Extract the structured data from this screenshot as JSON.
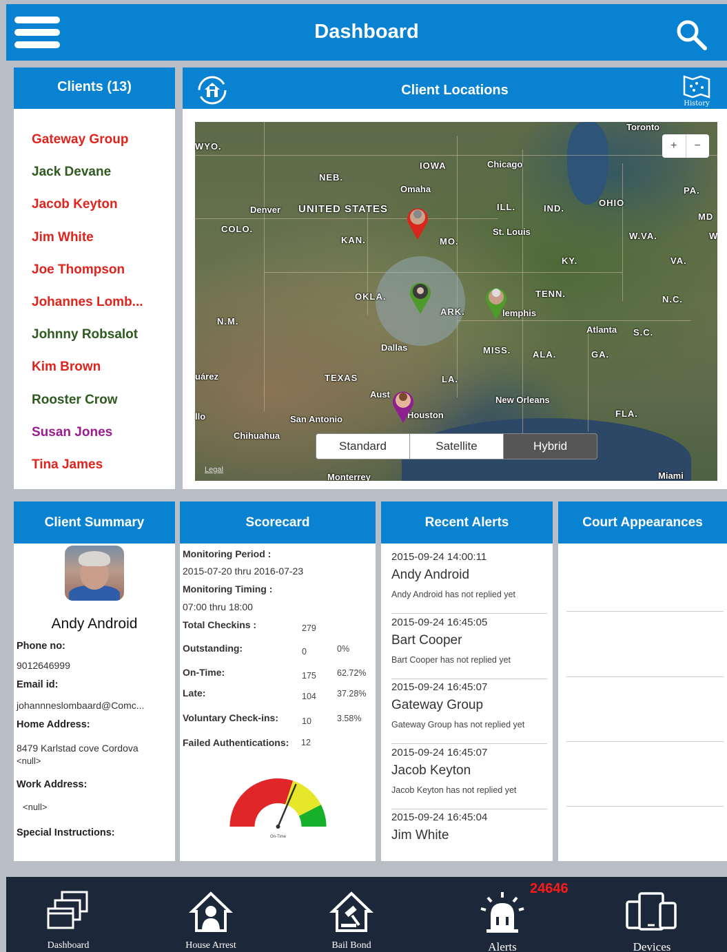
{
  "header": {
    "title": "Dashboard"
  },
  "clients": {
    "title": "Clients (13)",
    "items": [
      {
        "label": "Gateway Group",
        "color": "#e0231c"
      },
      {
        "label": "Jack Devane",
        "color": "#2e5a1f"
      },
      {
        "label": "Jacob Keyton",
        "color": "#e0231c"
      },
      {
        "label": "Jim White",
        "color": "#e0231c"
      },
      {
        "label": "Joe Thompson",
        "color": "#e0231c"
      },
      {
        "label": "Johannes Lomb...",
        "color": "#e0231c"
      },
      {
        "label": "Johnny Robsalot",
        "color": "#2e5a1f"
      },
      {
        "label": "Kim  Brown",
        "color": "#e0231c"
      },
      {
        "label": "Rooster Crow",
        "color": "#2e5a1f"
      },
      {
        "label": "Susan Jones",
        "color": "#9b1b8f"
      },
      {
        "label": "Tina James",
        "color": "#e0231c"
      }
    ]
  },
  "map_panel": {
    "title": "Client Locations",
    "history_label": "History",
    "zoom_in": "+",
    "zoom_out": "−",
    "legal": "Legal",
    "map_types": [
      "Standard",
      "Satellite",
      "Hybrid"
    ],
    "selected_map_type": "Hybrid",
    "labels": {
      "toronto": "Toronto",
      "chicago": "Chicago",
      "iowa": "IOWA",
      "neb": "NEB.",
      "omaha": "Omaha",
      "pa": "PA.",
      "denver": "Denver",
      "us": "UNITED STATES",
      "ill": "ILL.",
      "ind": "IND.",
      "ohio": "OHIO",
      "md": "MD",
      "colo": "COLO.",
      "stlouis": "St. Louis",
      "kan": "KAN.",
      "mo": "MO.",
      "wva": "W.VA.",
      "ky": "KY.",
      "va": "VA.",
      "tenn": "TENN.",
      "okla": "OKLA.",
      "nc": "N.C.",
      "ark": "ARK.",
      "memphis": "lemphis",
      "nm": "N.M.",
      "atlanta": "Atlanta",
      "sc": "S.C.",
      "dallas": "Dallas",
      "miss": "MISS.",
      "ala": "ALA.",
      "ga": "GA.",
      "juarez": "uárez",
      "texas": "TEXAS",
      "la": "LA.",
      "austin": "Aust",
      "neworleans": "New Orleans",
      "houston": "Houston",
      "llo": "llo",
      "sanantonio": "San Antonio",
      "fla": "FLA.",
      "chihuahua": "Chihuahua",
      "monterrey": "Monterrey",
      "miami": "Miami",
      "wyo": "WYO.",
      "w": "W"
    },
    "pin_colors": [
      "#d9261c",
      "#4e9a2a",
      "#4e9a2a",
      "#8d1f8f"
    ]
  },
  "summary": {
    "title": "Client Summary",
    "name": "Andy Android",
    "phone_label": "Phone no:",
    "phone": "9012646999",
    "email_label": "Email id:",
    "email": "johannneslombaard@Comc...",
    "home_label": "Home Address:",
    "home_line1": "8479 Karlstad cove Cordova",
    "home_line2": "<null>",
    "work_label": "Work Address:",
    "work": "<null>",
    "special_label": "Special Instructions:"
  },
  "scorecard": {
    "title": "Scorecard",
    "period_label": "Monitoring Period :",
    "period": "2015-07-20 thru 2016-07-23",
    "timing_label": "Monitoring Timing :",
    "timing": "07:00 thru 18:00",
    "rows": [
      {
        "label": "Total Checkins :",
        "count": "279",
        "pct": ""
      },
      {
        "label": "Outstanding:",
        "count": "0",
        "pct": "0%"
      },
      {
        "label": "On-Time:",
        "count": "175",
        "pct": "62.72%"
      },
      {
        "label": "Late:",
        "count": "104",
        "pct": "37.28%"
      },
      {
        "label": "Voluntary Check-ins:",
        "count": "10",
        "pct": "3.58%"
      },
      {
        "label": "Failed Authentications:",
        "count": "12",
        "pct": ""
      }
    ],
    "gauge_label": "On-Time",
    "gauge_value": 0.6272
  },
  "alerts": {
    "title": "Recent Alerts",
    "items": [
      {
        "time": "2015-09-24 14:00:11",
        "who": "Andy Android",
        "msg": "Andy Android has not replied yet"
      },
      {
        "time": "2015-09-24 16:45:05",
        "who": "Bart Cooper",
        "msg": "Bart Cooper has not replied yet"
      },
      {
        "time": "2015-09-24 16:45:07",
        "who": "Gateway Group",
        "msg": "Gateway Group has not replied yet"
      },
      {
        "time": "2015-09-24 16:45:07",
        "who": "Jacob Keyton",
        "msg": "Jacob Keyton has not replied yet"
      },
      {
        "time": "2015-09-24 16:45:04",
        "who": "Jim White",
        "msg": ""
      }
    ]
  },
  "court": {
    "title": "Court Appearances"
  },
  "tabbar": {
    "dashboard": "Dashboard",
    "house_arrest": "House Arrest",
    "bail_bond": "Bail Bond",
    "alerts": "Alerts",
    "alerts_badge": "24646",
    "devices": "Devices"
  }
}
